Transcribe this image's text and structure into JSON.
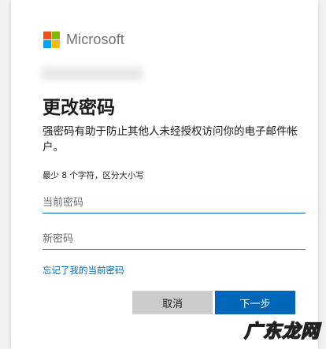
{
  "brand": {
    "name": "Microsoft",
    "colors": [
      "#f25022",
      "#7fba00",
      "#00a4ef",
      "#ffb900"
    ]
  },
  "title": "更改密码",
  "subtitle": "强密码有助于防止其他人未经授权访问你的电子邮件帐户。",
  "hint": "最少 8 个字符，区分大小写",
  "fields": {
    "current_password": {
      "placeholder": "当前密码",
      "value": ""
    },
    "new_password": {
      "placeholder": "新密码",
      "value": ""
    }
  },
  "forgot_link": "忘记了我的当前密码",
  "buttons": {
    "cancel": "取消",
    "next": "下一步"
  },
  "watermark": "广东龙网",
  "colors": {
    "accent": "#0067b8",
    "cancel_bg": "#cccccc"
  }
}
